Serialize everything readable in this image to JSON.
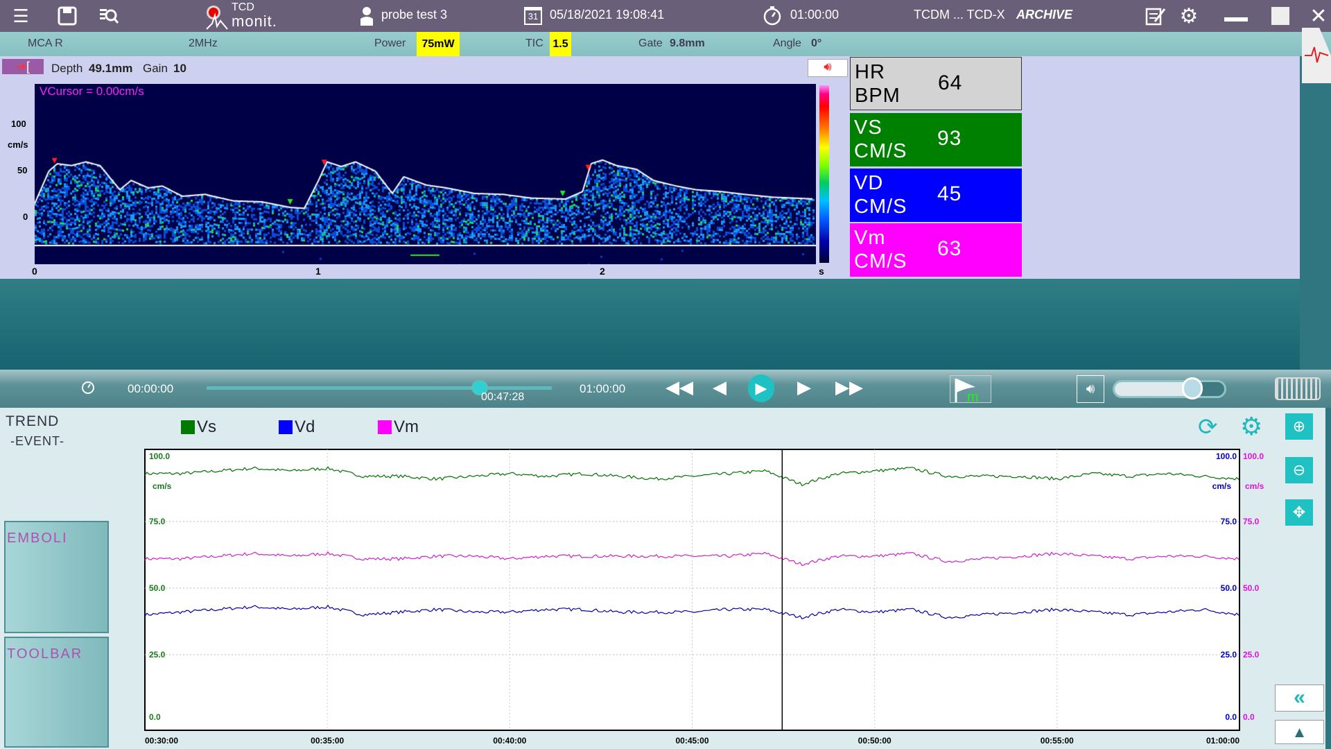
{
  "topbar": {
    "logo_line1": "TCD",
    "logo_line2": "monit.",
    "patient": "probe test 3",
    "calendar_day": "31",
    "datetime": "05/18/2021  19:08:41",
    "duration": "01:00:00",
    "device": "TCDM ... TCD-X",
    "mode": "ARCHIVE",
    "icons": [
      "menu-icon",
      "save-icon",
      "search-document-icon",
      "user-icon",
      "calendar-icon",
      "stopwatch-icon",
      "notes-icon",
      "gear-icon",
      "minimize-icon",
      "maximize-icon",
      "close-icon"
    ]
  },
  "params": {
    "vessel": "MCA R",
    "frequency": "2MHz",
    "power_label": "Power",
    "power_value": "75mW",
    "tic_label": "TIC",
    "tic_value": "1.5",
    "gate_label": "Gate",
    "gate_value": "9.8mm",
    "angle_label": "Angle",
    "angle_value": "0°",
    "highlight_color": "#ffff00"
  },
  "doppler": {
    "depth_label": "Depth",
    "depth_value": "49.1mm",
    "gain_label": "Gain",
    "gain_value": "10",
    "vcursor": "VCursor = 0.00cm/s",
    "y_unit": "cm/s",
    "x_unit": "s",
    "y_ticks": [
      "100",
      "50",
      "0"
    ],
    "x_ticks": [
      "0",
      "1",
      "2"
    ]
  },
  "metrics": [
    {
      "label1": "HR",
      "label2": "BPM",
      "value": "64",
      "bg": "#d3d3d3",
      "fg": "#000000"
    },
    {
      "label1": "VS",
      "label2": "CM/S",
      "value": "93",
      "bg": "#008000",
      "fg": "#ffffff"
    },
    {
      "label1": "VD",
      "label2": "CM/S",
      "value": "45",
      "bg": "#0000ff",
      "fg": "#ffffff"
    },
    {
      "label1": "Vm",
      "label2": "CM/S",
      "value": "63",
      "bg": "#ff00ff",
      "fg": "#ffffff"
    }
  ],
  "playback": {
    "start": "00:00:00",
    "current": "00:47:28",
    "end": "01:00:00",
    "progress": 0.791,
    "volume": 0.7
  },
  "trend": {
    "title": "Trend",
    "subtitle": "-EVENT-",
    "emboli": "EMBOLI",
    "toolbar": "TOOLBAR"
  },
  "chart_data": [
    {
      "type": "heatmap",
      "title": "",
      "xlabel": "s",
      "ylabel": "cm/s",
      "xlim": [
        0,
        2.75
      ],
      "ylim": [
        -40,
        120
      ],
      "x_ticks": [
        0,
        1,
        2
      ],
      "y_ticks": [
        0,
        50,
        100
      ],
      "envelope": {
        "t": [
          0,
          0.05,
          0.08,
          0.13,
          0.18,
          0.23,
          0.3,
          0.34,
          0.4,
          0.45,
          0.52,
          0.6,
          0.7,
          0.8,
          0.9,
          0.95,
          1.0,
          1.03,
          1.08,
          1.13,
          1.2,
          1.26,
          1.3,
          1.38,
          1.45,
          1.55,
          1.65,
          1.75,
          1.87,
          1.93,
          1.96,
          2.0,
          2.05,
          2.12,
          2.18,
          2.26,
          2.33,
          2.42,
          2.5,
          2.6,
          2.75
        ],
        "v": [
          45,
          80,
          88,
          86,
          90,
          86,
          60,
          70,
          62,
          64,
          53,
          55,
          48,
          47,
          41,
          40,
          70,
          90,
          85,
          90,
          80,
          56,
          74,
          65,
          62,
          56,
          55,
          51,
          50,
          58,
          88,
          92,
          86,
          82,
          70,
          64,
          60,
          58,
          55,
          52,
          50
        ]
      }
    },
    {
      "type": "line",
      "title": "",
      "legend": [
        "Vs",
        "Vd",
        "Vm"
      ],
      "legend_placement": "top",
      "ylabel": "cm/s",
      "ylim": [
        0,
        100
      ],
      "y_ticks": [
        "0.0",
        "25.0",
        "50.0",
        "75.0",
        "100.0"
      ],
      "x_ticks": [
        "00:30:00",
        "00:35:00",
        "00:40:00",
        "00:45:00",
        "00:50:00",
        "00:55:00",
        "01:00:00"
      ],
      "xlim": [
        "00:30:00",
        "01:00:00"
      ],
      "cursor": "00:47:28",
      "grid": true,
      "x_minutes": [
        30,
        31,
        32,
        33,
        34,
        35,
        36,
        37,
        38,
        39,
        40,
        41,
        42,
        43,
        44,
        45,
        46,
        47,
        48,
        49,
        50,
        51,
        52,
        53,
        54,
        55,
        56,
        57,
        58,
        59,
        60
      ],
      "series": [
        {
          "name": "Vs",
          "color": "#007000",
          "values": [
            93,
            93,
            94,
            95,
            94,
            95,
            92,
            92,
            91,
            92,
            93,
            92,
            93,
            92,
            91,
            92,
            93,
            94,
            89,
            93,
            94,
            95,
            92,
            92,
            92,
            91,
            93,
            92,
            93,
            92,
            91
          ]
        },
        {
          "name": "Vd",
          "color": "#0000aa",
          "values": [
            40,
            41,
            42,
            43,
            42,
            43,
            40,
            41,
            42,
            41,
            41,
            42,
            42,
            41,
            41,
            41,
            42,
            42,
            39,
            42,
            41,
            42,
            39,
            40,
            41,
            42,
            41,
            40,
            41,
            42,
            40
          ]
        },
        {
          "name": "Vm",
          "color": "#cc22cc",
          "values": [
            61,
            61,
            62,
            63,
            62,
            63,
            61,
            61,
            62,
            62,
            61,
            62,
            62,
            62,
            62,
            62,
            62,
            63,
            59,
            62,
            62,
            63,
            60,
            61,
            62,
            63,
            62,
            61,
            62,
            62,
            61
          ]
        }
      ]
    }
  ]
}
